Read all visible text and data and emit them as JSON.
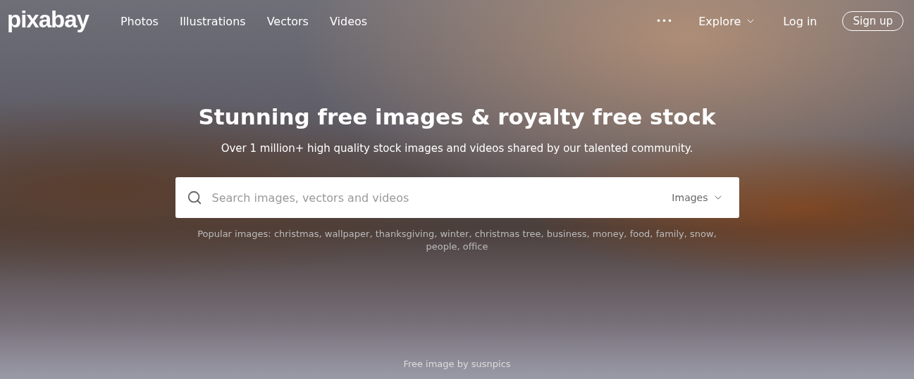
{
  "header": {
    "logo": "pixabay",
    "nav": [
      "Photos",
      "Illustrations",
      "Vectors",
      "Videos"
    ],
    "more": "•••",
    "explore": "Explore",
    "login": "Log in",
    "signup": "Sign up"
  },
  "hero": {
    "title": "Stunning free images & royalty free stock",
    "subtitle": "Over 1 million+ high quality stock images and videos shared by our talented community.",
    "search": {
      "placeholder": "Search images, vectors and videos",
      "type": "Images"
    },
    "popular": {
      "label": "Popular images:",
      "tags": [
        "christmas,",
        "wallpaper,",
        "thanksgiving,",
        "winter,",
        "christmas tree,",
        "business,",
        "money,",
        "food,",
        "family,",
        "snow,",
        "people,",
        "office"
      ]
    },
    "credit": "Free image by susnpics"
  }
}
